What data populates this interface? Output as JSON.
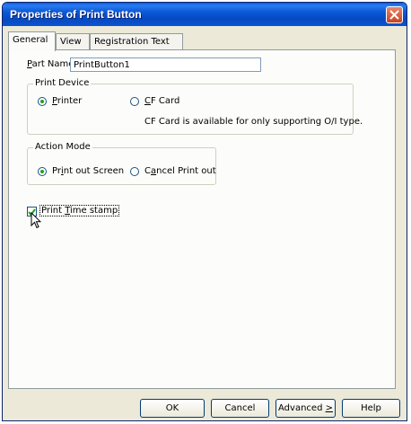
{
  "window": {
    "title": "Properties of Print Button"
  },
  "tabs": [
    {
      "label": "General"
    },
    {
      "label": "View"
    },
    {
      "label": "Registration Text"
    }
  ],
  "part_name": {
    "label_prefix": "P",
    "label_rest": "art Name:",
    "value": "PrintButton1"
  },
  "print_device": {
    "title": "Print Device",
    "options": [
      {
        "label_prefix": "P",
        "label_rest": "rinter",
        "selected": true
      },
      {
        "label_prefix": "C",
        "label_rest": "F Card",
        "selected": false
      }
    ],
    "note": "CF Card is available for only supporting O/I type."
  },
  "action_mode": {
    "title": "Action Mode",
    "options": [
      {
        "label_prefix": "Pr",
        "label_underline": "i",
        "label_rest": "nt out Screen",
        "selected": true
      },
      {
        "label_prefix": "C",
        "label_underline": "a",
        "label_rest": "ncel Print out",
        "selected": false
      }
    ]
  },
  "print_time_stamp": {
    "label_prefix": "Print ",
    "label_underline": "T",
    "label_rest": "ime stamp",
    "checked": true
  },
  "buttons": {
    "ok": "OK",
    "cancel": "Cancel",
    "advanced_prefix": "Advanced ",
    "advanced_underline": ">",
    "help": "Help"
  }
}
